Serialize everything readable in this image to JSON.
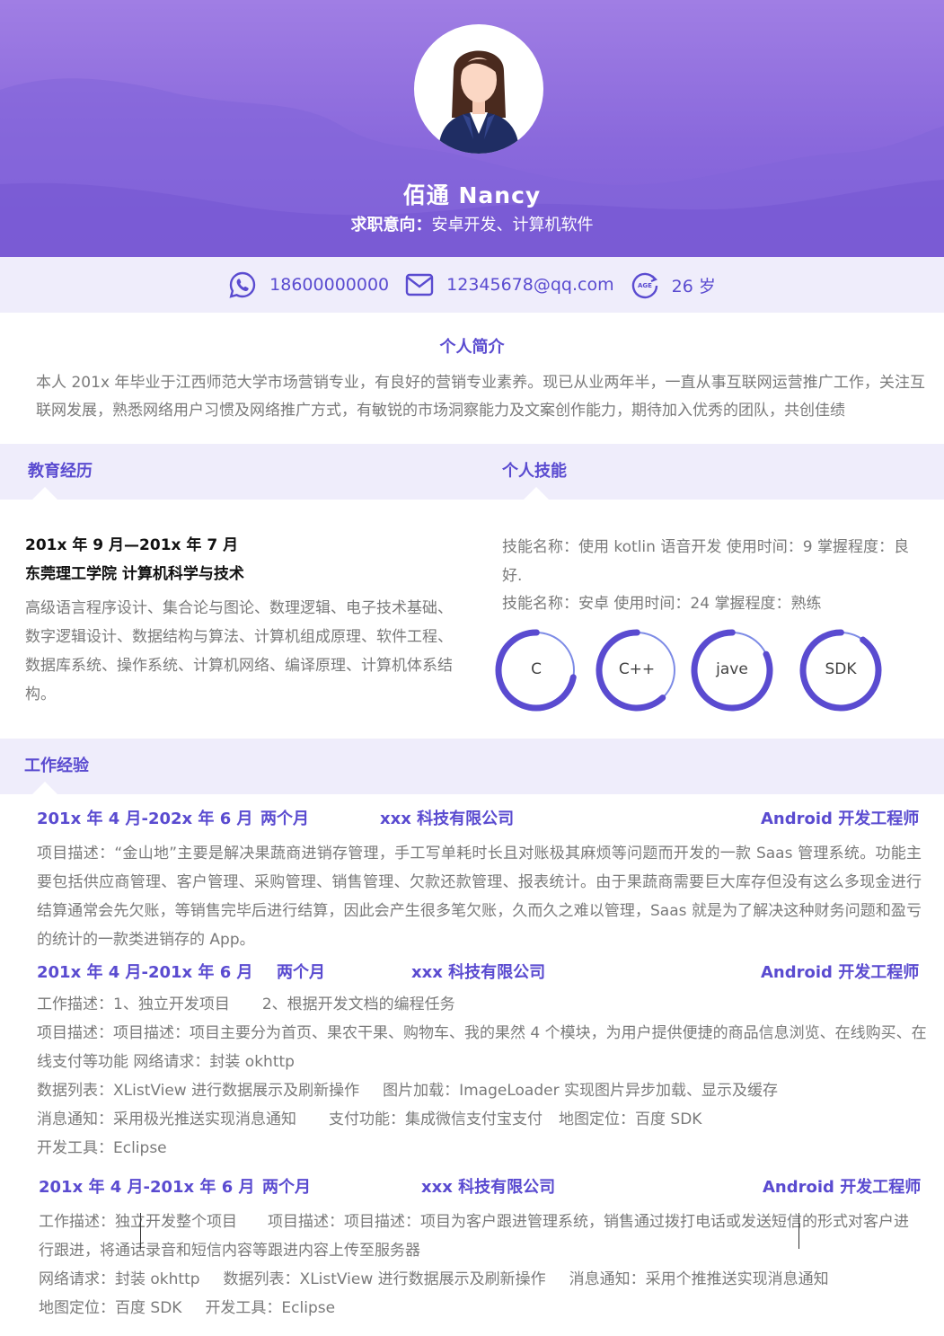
{
  "header": {
    "name": "佰通  Nancy",
    "objective_label": "求职意向：",
    "objective_value": "安卓开发、计算机软件"
  },
  "contact": {
    "phone": "18600000000",
    "email": "12345678@qq.com",
    "age": "26 岁",
    "age_icon_text": "AGE"
  },
  "intro": {
    "title": "个人简介",
    "text": "本人 201x 年毕业于江西师范大学市场营销专业，有良好的营销专业素养。现已从业两年半，一直从事互联网运营推广工作，关注互联网发展，熟悉网络用户习惯及网络推广方式，有敏锐的市场洞察能力及文案创作能力，期待加入优秀的团队，共创佳绩"
  },
  "education": {
    "title": "教育经历",
    "date": "201x 年 9 月—201x 年 7 月",
    "school": "东莞理工学院 计算机科学与技术",
    "courses": "高级语言程序设计、集合论与图论、数理逻辑、电子技术基础、数字逻辑设计、数据结构与算法、计算机组成原理、软件工程、数据库系统、操作系统、计算机网络、编译原理、计算机体系结构。"
  },
  "skills": {
    "title": "个人技能",
    "line1": "技能名称：使用 kotlin 语音开发  使用时间：9  掌握程度：良好.",
    "line2": "技能名称：安卓  使用时间：24  掌握程度：熟练",
    "rings": [
      {
        "label": "C",
        "level": 0.72
      },
      {
        "label": "C++",
        "level": 0.62
      },
      {
        "label": "jave",
        "level": 0.82
      },
      {
        "label": "SDK",
        "level": 0.9
      }
    ],
    "ring_color": "#5a4bd0",
    "ring_track_color": "#7d8be6"
  },
  "work": {
    "title": "工作经验",
    "jobs": [
      {
        "period": "201x 年 4 月-202x 年 6 月",
        "duration": "两个月",
        "company": "xxx 科技有限公司",
        "role": "Android 开发工程师",
        "lines": [
          "项目描述：“金山地”主要是解决果蔬商进销存管理，手工写单耗时长且对账极其麻烦等问题而开发的一款 Saas 管理系统。功能主要包括供应商管理、客户管理、采购管理、销售管理、欠款还款管理、报表统计。由于果蔬商需要巨大库存但没有这么多现金进行结算通常会先欠账，等销售完毕后进行结算，因此会产生很多笔欠账，久而久之难以管理，Saas 就是为了解决这种财务问题和盈亏的统计的一款类进销存的 App。"
        ]
      },
      {
        "period": "201x 年 4 月-201x 年 6 月",
        "duration": "两个月",
        "company": "xxx 科技有限公司",
        "role": "Android 开发工程师",
        "work_desc_a": "工作描述：1、独立开发项目",
        "work_desc_b": "2、根据开发文档的编程任务",
        "project": "项目描述：项目描述：项目主要分为首页、果农干果、购物车、我的果然 4 个模块，为用户提供便捷的商品信息浏览、在线购买、在线支付等功能    网络请求：封装 okhttp",
        "data_list": "数据列表：XListView 进行数据展示及刷新操作",
        "image_load": "图片加载：ImageLoader 实现图片异步加载、显示及缓存",
        "push": "消息通知：采用极光推送实现消息通知",
        "pay": "支付功能：集成微信支付宝支付",
        "map": "地图定位：百度 SDK",
        "tools": "开发工具：Eclipse"
      },
      {
        "period": "201x 年 4 月-201x 年 6 月",
        "duration": "两个月",
        "company": "xxx 科技有限公司",
        "role": "Android 开发工程师",
        "work_desc": "工作描述：独立开发整个项目",
        "project": "项目描述：项目描述：项目为客户跟进管理系统，销售通过拨打电话或发送短信的形式对客户进行跟进，将通话录音和短信内容等跟进内容上传至服务器",
        "network": "网络请求：封装 okhttp",
        "data_list": "数据列表：XListView 进行数据展示及刷新操作",
        "push": "消息通知：采用个推推送实现消息通知",
        "map": "地图定位：百度 SDK",
        "tools": "开发工具：Eclipse"
      }
    ]
  }
}
